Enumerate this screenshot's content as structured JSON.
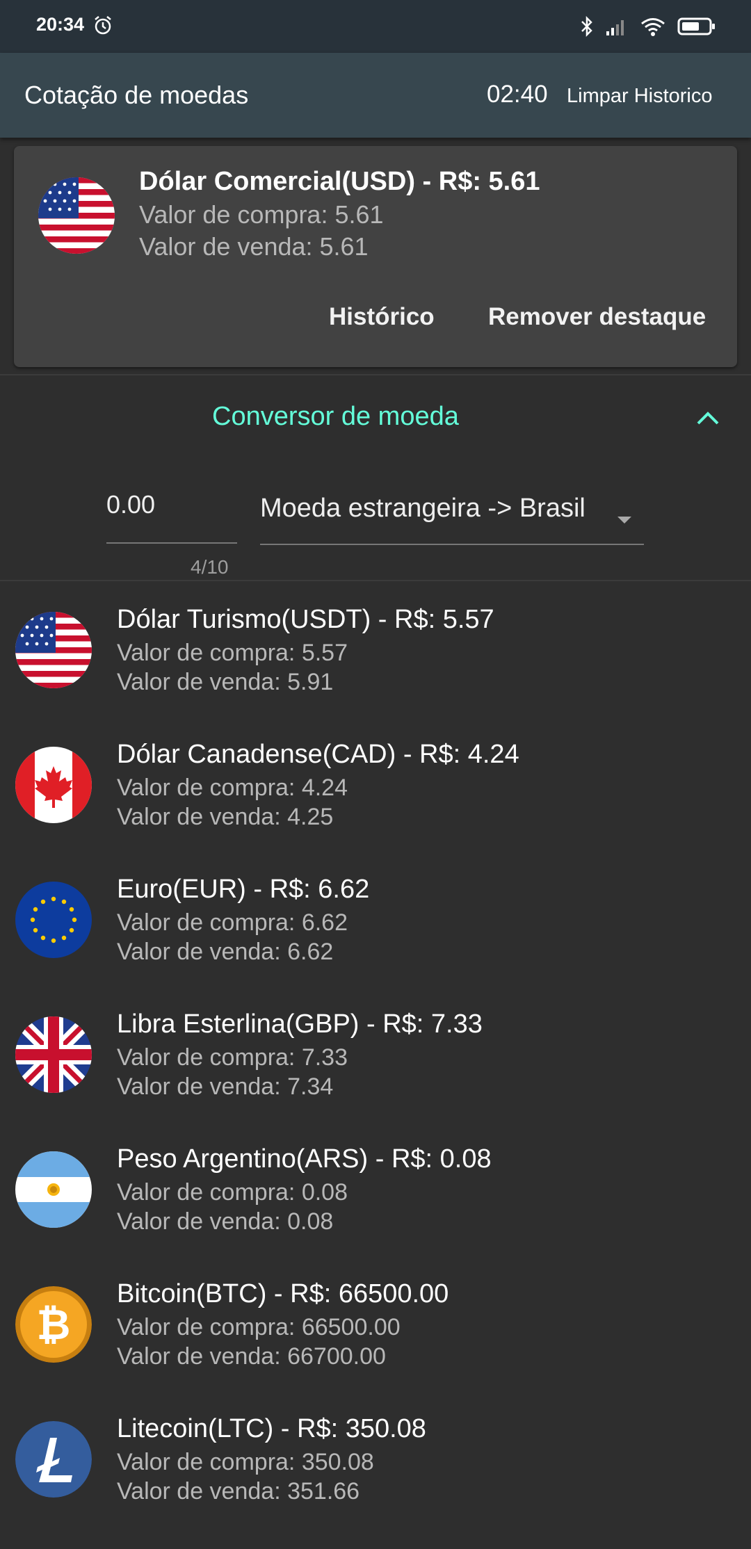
{
  "status": {
    "time": "20:34"
  },
  "header": {
    "title": "Cotação de moedas",
    "timer": "02:40",
    "clear_label": "Limpar Historico"
  },
  "featured": {
    "title": "Dólar Comercial(USD) - R$: 5.61",
    "buy": "Valor de compra: 5.61",
    "sell": "Valor de venda: 5.61",
    "history_label": "Histórico",
    "remove_label": "Remover destaque",
    "flag": "usa-flag-icon"
  },
  "converter": {
    "title": "Conversor de moeda",
    "amount": "0.00",
    "counter": "4/10",
    "direction": "Moeda estrangeira -> Brasil"
  },
  "currencies": [
    {
      "title": "Dólar Turismo(USDT) - R$: 5.57",
      "buy": "Valor de compra: 5.57",
      "sell": "Valor de venda: 5.91",
      "flag": "usa-flag-icon"
    },
    {
      "title": "Dólar Canadense(CAD) - R$: 4.24",
      "buy": "Valor de compra: 4.24",
      "sell": "Valor de venda: 4.25",
      "flag": "canada-flag-icon"
    },
    {
      "title": "Euro(EUR) - R$: 6.62",
      "buy": "Valor de compra: 6.62",
      "sell": "Valor de venda: 6.62",
      "flag": "eu-flag-icon"
    },
    {
      "title": "Libra Esterlina(GBP) - R$: 7.33",
      "buy": "Valor de compra: 7.33",
      "sell": "Valor de venda: 7.34",
      "flag": "uk-flag-icon"
    },
    {
      "title": "Peso Argentino(ARS) - R$: 0.08",
      "buy": "Valor de compra: 0.08",
      "sell": "Valor de venda: 0.08",
      "flag": "argentina-flag-icon"
    },
    {
      "title": "Bitcoin(BTC) - R$: 66500.00",
      "buy": "Valor de compra: 66500.00",
      "sell": "Valor de venda: 66700.00",
      "flag": "bitcoin-icon"
    },
    {
      "title": "Litecoin(LTC) - R$: 350.08",
      "buy": "Valor de compra: 350.08",
      "sell": "Valor de venda: 351.66",
      "flag": "litecoin-icon"
    }
  ],
  "colors": {
    "accent": "#64ffda",
    "appbar": "#37474f",
    "statusbar": "#28323a",
    "background": "#2e2e2e",
    "card": "#424242"
  }
}
